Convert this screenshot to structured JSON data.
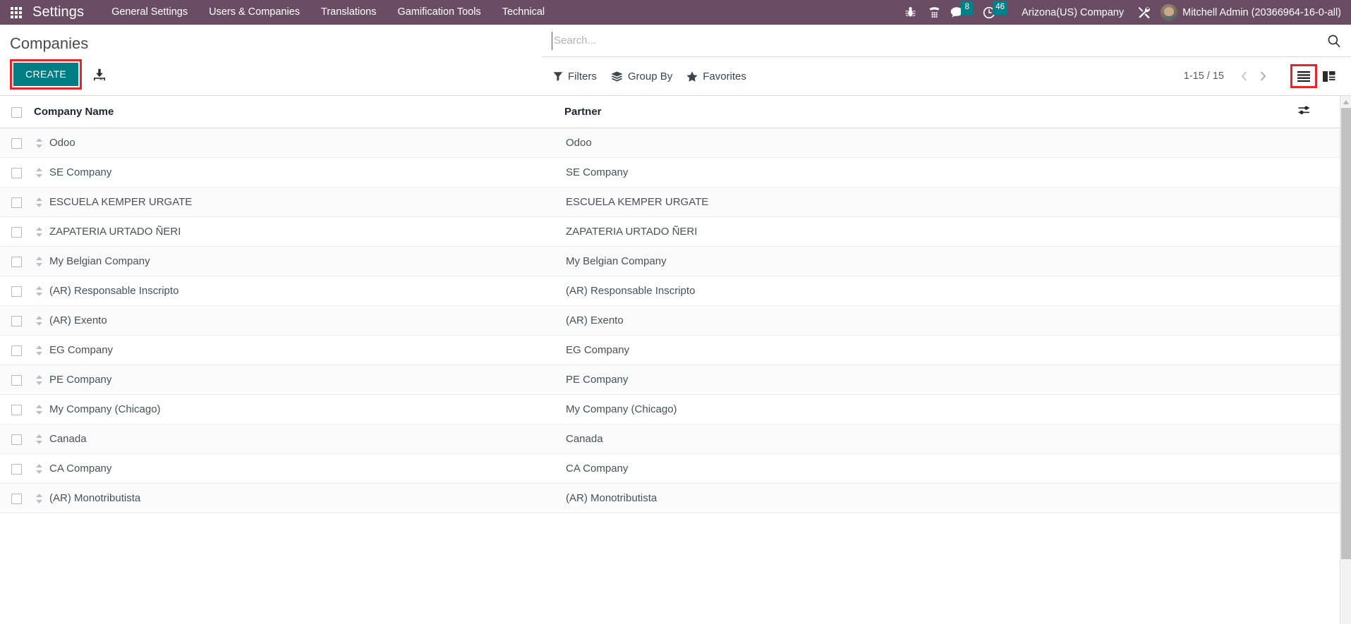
{
  "navbar": {
    "apps_icon": "apps-grid-icon",
    "brand": "Settings",
    "menu": [
      {
        "label": "General Settings"
      },
      {
        "label": "Users & Companies"
      },
      {
        "label": "Translations"
      },
      {
        "label": "Gamification Tools"
      },
      {
        "label": "Technical"
      }
    ],
    "icons": [
      {
        "name": "bug-icon",
        "label": ""
      },
      {
        "name": "dialpad-icon",
        "label": ""
      }
    ],
    "messages_badge": "8",
    "activities_badge": "46",
    "company_name": "Arizona(US) Company",
    "tools_icon": "tools-icon",
    "user_name": "Mitchell Admin (20366964-16-0-all)",
    "badge_color": "#00818a",
    "navbar_color": "#6b4d63"
  },
  "control_panel": {
    "page_title": "Companies",
    "create_label": "CREATE",
    "create_color": "#017e84",
    "highlight_color": "#e4262c",
    "import_icon": "import-icon",
    "search": {
      "value": "",
      "placeholder": "Search..."
    },
    "search_icon": "search-icon",
    "filters_label": "Filters",
    "group_by_label": "Group By",
    "favorites_label": "Favorites",
    "pager": "1-15 / 15",
    "prev_icon": "chevron-left-icon",
    "next_icon": "chevron-right-icon",
    "view_list_icon": "list-view-icon",
    "view_kanban_icon": "kanban-view-icon",
    "active_view": "list"
  },
  "list": {
    "columns": [
      "Company Name",
      "Partner"
    ],
    "options_icon": "column-options-icon",
    "rows": [
      {
        "name": "Odoo",
        "partner": "Odoo"
      },
      {
        "name": "SE Company",
        "partner": "SE Company"
      },
      {
        "name": "ESCUELA KEMPER URGATE",
        "partner": "ESCUELA KEMPER URGATE"
      },
      {
        "name": "ZAPATERIA URTADO ÑERI",
        "partner": "ZAPATERIA URTADO ÑERI"
      },
      {
        "name": "My Belgian Company",
        "partner": "My Belgian Company"
      },
      {
        "name": "(AR) Responsable Inscripto",
        "partner": "(AR) Responsable Inscripto"
      },
      {
        "name": "(AR) Exento",
        "partner": "(AR) Exento"
      },
      {
        "name": "EG Company",
        "partner": "EG Company"
      },
      {
        "name": "PE Company",
        "partner": "PE Company"
      },
      {
        "name": "My Company (Chicago)",
        "partner": "My Company (Chicago)"
      },
      {
        "name": "Canada",
        "partner": "Canada"
      },
      {
        "name": "CA Company",
        "partner": "CA Company"
      },
      {
        "name": "(AR) Monotributista",
        "partner": "(AR) Monotributista"
      }
    ]
  }
}
